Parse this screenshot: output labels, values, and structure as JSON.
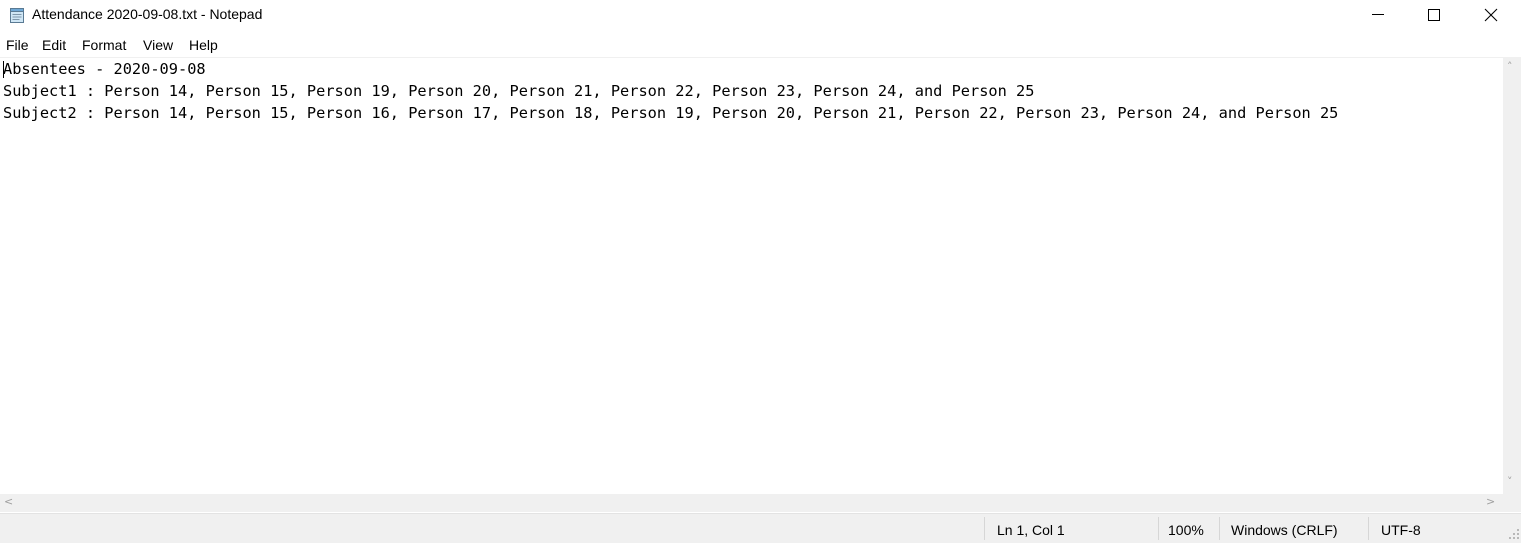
{
  "window": {
    "title": "Attendance 2020-09-08.txt - Notepad",
    "icons": {
      "app": "notepad-icon",
      "minimize": "minimize-icon",
      "maximize": "maximize-icon",
      "close": "close-icon"
    }
  },
  "menubar": {
    "items": [
      "File",
      "Edit",
      "Format",
      "View",
      "Help"
    ]
  },
  "editor": {
    "lines": [
      "Absentees - 2020-09-08",
      "Subject1 : Person 14, Person 15, Person 19, Person 20, Person 21, Person 22, Person 23, Person 24, and Person 25",
      "Subject2 : Person 14, Person 15, Person 16, Person 17, Person 18, Person 19, Person 20, Person 21, Person 22, Person 23, Person 24, and Person 25"
    ]
  },
  "statusbar": {
    "position": "Ln 1, Col 1",
    "zoom": "100%",
    "line_ending": "Windows (CRLF)",
    "encoding": "UTF-8"
  },
  "colors": {
    "chrome": "#f0f0f0",
    "text": "#000000",
    "scroll_arrow": "#a0a0a0"
  }
}
